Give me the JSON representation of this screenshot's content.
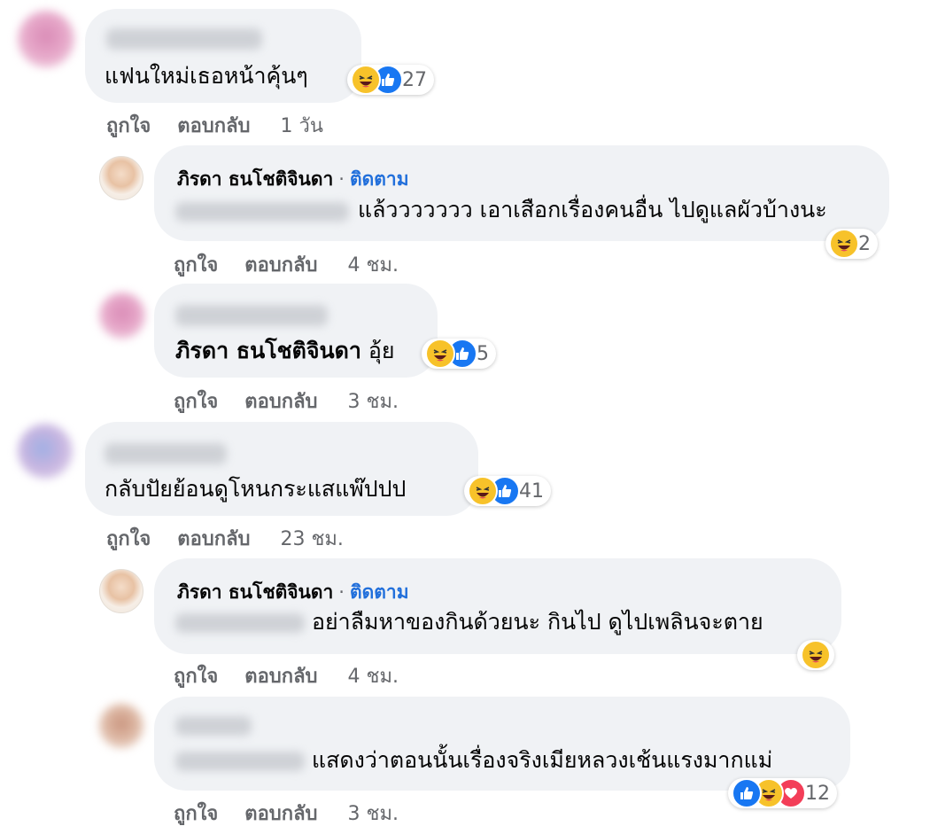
{
  "comments": [
    {
      "text": "แฟนใหม่เธอหน้าคุ้นๆ",
      "reaction_count": "27",
      "actions": {
        "like": "ถูกใจ",
        "reply": "ตอบกลับ",
        "time": "1 วัน"
      }
    },
    {
      "author": "ภิรดา ธนโชติจินดา",
      "separator": "·",
      "follow": "ติดตาม",
      "text": "แล้ววววววว เอาเสือกเรื่องคนอื่น ไปดูแลผัวบ้างนะ",
      "reaction_count": "2",
      "actions": {
        "like": "ถูกใจ",
        "reply": "ตอบกลับ",
        "time": "4 ชม."
      }
    },
    {
      "mention": "ภิรดา ธนโชติจินดา",
      "text": "อุ้ย",
      "reaction_count": "5",
      "actions": {
        "like": "ถูกใจ",
        "reply": "ตอบกลับ",
        "time": "3 ชม."
      }
    },
    {
      "text": "กลับปัยย้อนดูโหนกระแสแพ๊ปปป",
      "reaction_count": "41",
      "actions": {
        "like": "ถูกใจ",
        "reply": "ตอบกลับ",
        "time": "23 ชม."
      }
    },
    {
      "author": "ภิรดา ธนโชติจินดา",
      "separator": "·",
      "follow": "ติดตาม",
      "text": "อย่าลืมหาของกินด้วยนะ กินไป ดูไปเพลินจะตาย",
      "actions": {
        "like": "ถูกใจ",
        "reply": "ตอบกลับ",
        "time": "4 ชม."
      }
    },
    {
      "text": "แสดงว่าตอนนั้นเรื่องจริงเมียหลวงเช้นแรงมากแม่",
      "reaction_count": "12",
      "actions": {
        "like": "ถูกใจ",
        "reply": "ตอบกลับ",
        "time": "3 ชม."
      }
    }
  ],
  "colors": {
    "bubble": "#f0f2f5",
    "meta": "#65676b",
    "link": "#216fdb",
    "like_blue": "#1877f2",
    "haha_yellow": "#f7c22a",
    "love_red": "#f33e58"
  },
  "icons": [
    "haha-icon",
    "like-icon",
    "love-icon"
  ]
}
